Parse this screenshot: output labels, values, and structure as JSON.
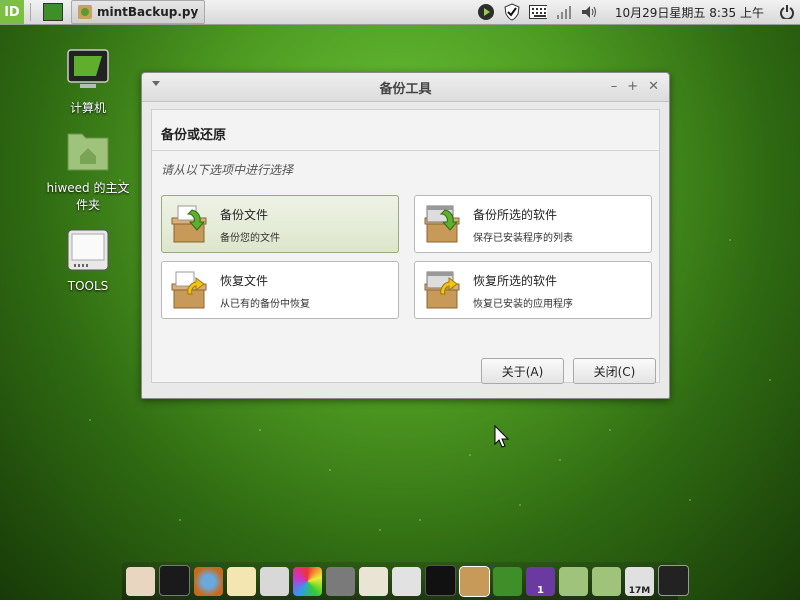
{
  "top_panel": {
    "menu_label": "lD",
    "task_title": "mintBackup.py",
    "clock": "10月29日星期五  8:35 上午"
  },
  "desktop": {
    "icons": [
      {
        "label": "计算机",
        "icon": "computer-icon"
      },
      {
        "label": "hiweed 的主文件夹",
        "icon": "home-folder-icon"
      },
      {
        "label": "TOOLS",
        "icon": "drive-icon"
      }
    ]
  },
  "window": {
    "title": "备份工具",
    "heading": "备份或还原",
    "subtitle": "请从以下选项中进行选择",
    "options": [
      {
        "title": "备份文件",
        "subtitle": "备份您的文件",
        "icon": "backup-files-icon",
        "selected": true
      },
      {
        "title": "备份所选的软件",
        "subtitle": "保存已安装程序的列表",
        "icon": "backup-software-icon",
        "selected": false
      },
      {
        "title": "恢复文件",
        "subtitle": "从已有的备份中恢复",
        "icon": "restore-files-icon",
        "selected": false
      },
      {
        "title": "恢复所选的软件",
        "subtitle": "恢复已安装的应用程序",
        "icon": "restore-software-icon",
        "selected": false
      }
    ],
    "buttons": {
      "about_label": "关于(A)",
      "close_label": "关闭(C)"
    }
  },
  "dock": {
    "badge_count": "1",
    "storage_label": "17M"
  },
  "colors": {
    "accent_green": "#6cc53a",
    "selected_bg": "#dde6cc"
  }
}
